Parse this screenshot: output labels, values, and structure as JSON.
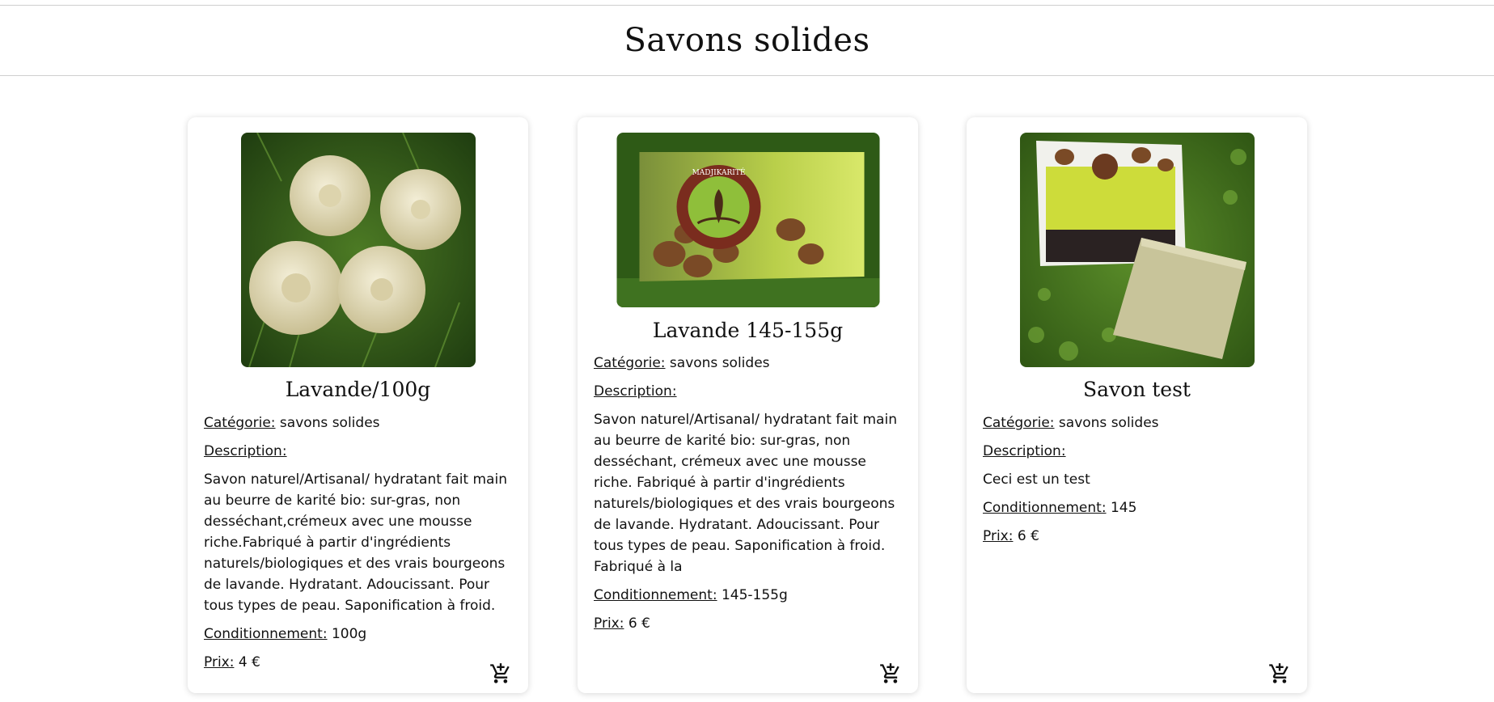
{
  "page": {
    "title": "Savons solides"
  },
  "products": [
    {
      "name": "Lavande/100g",
      "category_label": "Catégorie:",
      "category": "savons solides",
      "description_label": "Description:",
      "description": "Savon naturel/Artisanal/ hydratant fait main au beurre de karité bio: sur-gras, non desséchant,crémeux avec une mousse riche.Fabriqué à partir d'ingrédients naturels/biologiques et des vrais bourgeons de lavande. Hydratant. Adoucissant. Pour tous types de peau. Saponification à froid.",
      "packaging_label": "Conditionnement:",
      "packaging": "100g",
      "price_label": "Prix:",
      "price": "4 €",
      "image_icon": "soap-flowers-photo",
      "cart_icon": "add-to-cart-icon"
    },
    {
      "name": "Lavande 145-155g",
      "category_label": "Catégorie:",
      "category": "savons solides",
      "description_label": "Description:",
      "description": "Savon naturel/Artisanal/ hydratant fait main au beurre de karité bio: sur-gras, non desséchant, crémeux avec une mousse riche. Fabriqué à partir d'ingrédients naturels/biologiques et des vrais bourgeons de lavande. Hydratant. Adoucissant. Pour tous types de peau. Saponification à froid. Fabriqué à la",
      "packaging_label": "Conditionnement:",
      "packaging": "145-155g",
      "price_label": "Prix:",
      "price": "6 €",
      "image_icon": "soap-box-photo",
      "image_logo_text": "MADJIKARITÉ",
      "cart_icon": "add-to-cart-icon"
    },
    {
      "name": "Savon test",
      "category_label": "Catégorie:",
      "category": "savons solides",
      "description_label": "Description:",
      "description": "Ceci est un test",
      "packaging_label": "Conditionnement:",
      "packaging": "145",
      "price_label": "Prix:",
      "price": "6 €",
      "image_icon": "soap-bar-package-photo",
      "cart_icon": "add-to-cart-icon"
    }
  ],
  "colors": {
    "grass": "#3d6b1f",
    "soap_cream": "#e9e2c4",
    "divider": "#cfcfcf"
  }
}
